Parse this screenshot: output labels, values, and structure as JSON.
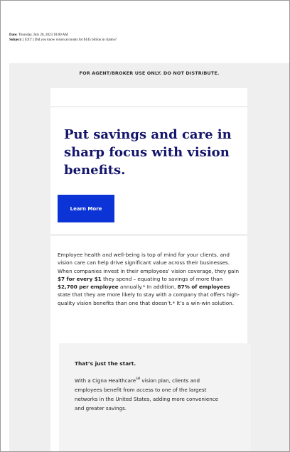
{
  "email": {
    "date_label": "Date:",
    "date_value": "Thursday, July 20, 2023 10:00 AM",
    "subject_label": "Subject:",
    "subject_value": "[ EXT ] Did you know vision accounts for $145 billion in claims?"
  },
  "notice": "FOR AGENT/BROKER USE ONLY. DO NOT DISTRIBUTE.",
  "hero": {
    "headline": "Put savings and care in sharp focus with vision benefits.",
    "cta_label": "Learn More"
  },
  "body": {
    "p1": "Employee health and well-being is top of mind for your clients, and vision care can help drive significant value across their businesses. When companies invest in their employees’ vision coverage, they gain ",
    "b1": "$7 for every $1",
    "p2": " they spend – equating to savings of more than ",
    "b2": "$2,700 per employee",
    "p3": " annually.* In addition, ",
    "b3": "87% of employees",
    "p4": " state that they are more likely to stay with a company that offers high-quality vision benefits than one that doesn’t.* It’s a win-win solution."
  },
  "callout": {
    "title": "That’s just the start.",
    "text_1": "With a Cigna Healthcare",
    "sup": "SM",
    "text_2": " vision plan, clients and employees benefit from access to one of the largest networks in the United States, adding more convenience and greater savings."
  },
  "colors": {
    "headline": "#14146b",
    "button": "#0b33d6",
    "page_gray": "#efefef"
  }
}
